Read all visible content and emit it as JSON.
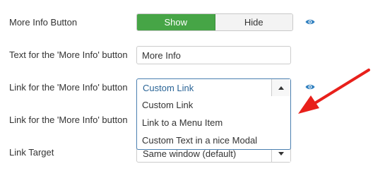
{
  "rows": {
    "more_info_button": {
      "label": "More Info Button",
      "options": [
        "Show",
        "Hide"
      ],
      "selected": "Show"
    },
    "more_info_text": {
      "label": "Text for the 'More Info' button",
      "value": "More Info"
    },
    "more_info_link": {
      "label": "Link for the 'More Info' button",
      "selected": "Custom Link",
      "options": [
        "Custom Link",
        "Link to a Menu Item",
        "Custom Text in a nice Modal"
      ]
    },
    "more_info_link_2": {
      "label": "Link for the 'More Info' button"
    },
    "link_target": {
      "label": "Link Target",
      "value": "Same window (default)"
    }
  },
  "icons": {
    "preview": "eye-icon",
    "select_caret_up": "caret-up-icon",
    "select_caret_down": "caret-down-icon",
    "annotation": "red-arrow-icon"
  },
  "colors": {
    "toggle_active": "#46a546",
    "link_blue": "#2a6496",
    "eye_blue": "#2f7fbf",
    "arrow_red": "#e8201b"
  }
}
